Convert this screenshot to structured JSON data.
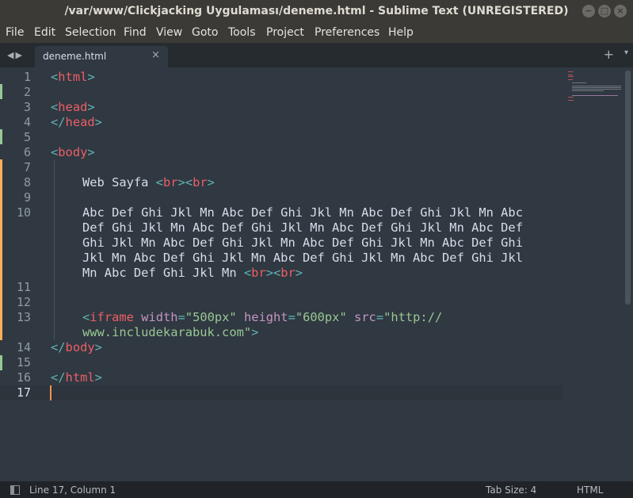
{
  "window": {
    "title": "/var/www/Clickjacking Uygulaması/deneme.html - Sublime Text (UNREGISTERED)",
    "controls": [
      "−",
      "□",
      "×"
    ]
  },
  "menu": [
    "File",
    "Edit",
    "Selection",
    "Find",
    "View",
    "Goto",
    "Tools",
    "Project",
    "Preferences",
    "Help"
  ],
  "tabbar": {
    "nav": "◀▶",
    "tab_name": "deneme.html",
    "close": "×",
    "plus": "+",
    "dropdown": "▾"
  },
  "gutter": {
    "line_numbers": [
      "1",
      "2",
      "3",
      "4",
      "5",
      "6",
      "7",
      "8",
      "9",
      "10",
      "11",
      "12",
      "13",
      "14",
      "15",
      "16",
      "17"
    ],
    "current_line": "17"
  },
  "code": {
    "line1": {
      "open": "<",
      "tag": "html",
      "close": ">"
    },
    "line3": {
      "open": "<",
      "tag": "head",
      "close": ">"
    },
    "line4": {
      "open": "</",
      "tag": "head",
      "close": ">"
    },
    "line6": {
      "open": "<",
      "tag": "body",
      "close": ">"
    },
    "line8": {
      "text": "Web Sayfa ",
      "br1_open": "<",
      "br1_tag": "br",
      "br1_close": ">",
      "br2_open": "<",
      "br2_tag": "br",
      "br2_close": ">"
    },
    "line10": {
      "wrap1": "Abc Def Ghi Jkl Mn Abc Def Ghi Jkl Mn Abc Def Ghi Jkl Mn Abc",
      "wrap2": "Def Ghi Jkl Mn Abc Def Ghi Jkl Mn Abc Def Ghi Jkl Mn Abc Def",
      "wrap3": "Ghi Jkl Mn Abc Def Ghi Jkl Mn Abc Def Ghi Jkl Mn Abc Def Ghi",
      "wrap4": "Jkl Mn Abc Def Ghi Jkl Mn Abc Def Ghi Jkl Mn Abc Def Ghi Jkl",
      "wrap5": "Mn Abc Def Ghi Jkl Mn ",
      "br1_open": "<",
      "br1_tag": "br",
      "br1_close": ">",
      "br2_open": "<",
      "br2_tag": "br",
      "br2_close": ">"
    },
    "line13": {
      "open": "<",
      "tag": "iframe",
      "attr1": "width",
      "eq1": "=",
      "val1": "\"500px\"",
      "attr2": "height",
      "eq2": "=",
      "val2": "\"600px\"",
      "attr3": "src",
      "eq3": "=",
      "val3a": "\"http://",
      "val3b": "www.includekarabuk.com\"",
      "close": ">"
    },
    "line14": {
      "open": "</",
      "tag": "body",
      "close": ">"
    },
    "line16": {
      "open": "</",
      "tag": "html",
      "close": ">"
    }
  },
  "status": {
    "position": "Line 17, Column 1",
    "tab_size": "Tab Size: 4",
    "syntax": "HTML"
  },
  "colors": {
    "background": "#303841",
    "tag": "#ec5f67",
    "punctuation": "#5fb3b3",
    "attribute": "#c594c5",
    "string": "#99c794",
    "text": "#d8dee9",
    "modified_marker": "#f9ae58",
    "added_marker": "#99c794"
  }
}
